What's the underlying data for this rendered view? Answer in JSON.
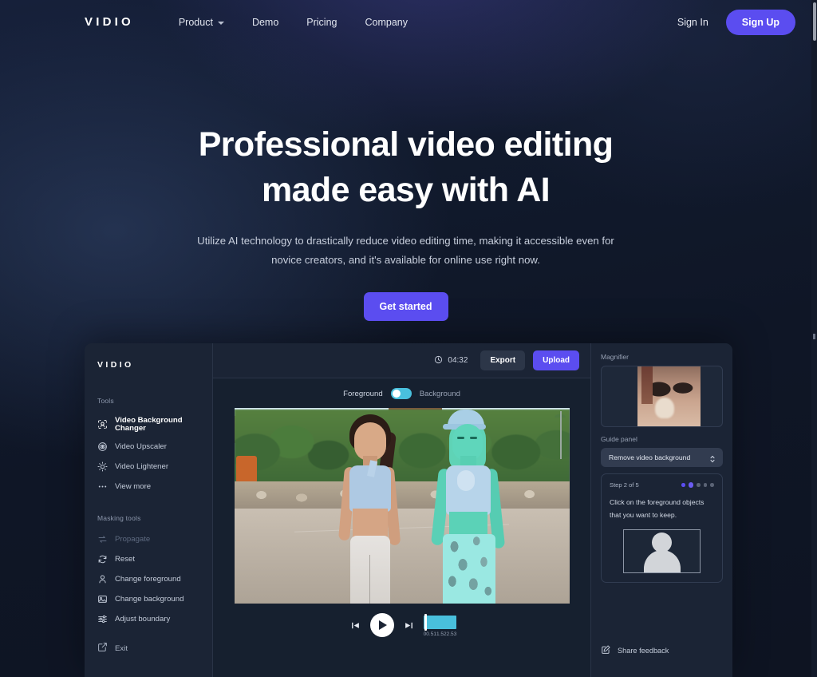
{
  "nav": {
    "brand": "VIDIO",
    "links": [
      {
        "label": "Product",
        "has_caret": true
      },
      {
        "label": "Demo",
        "has_caret": false
      },
      {
        "label": "Pricing",
        "has_caret": false
      },
      {
        "label": "Company",
        "has_caret": false
      }
    ],
    "sign_in": "Sign In",
    "sign_up": "Sign Up"
  },
  "hero": {
    "title_line1": "Professional video editing",
    "title_line2": "made easy with AI",
    "subtitle": "Utilize AI technology to drastically reduce video editing time, making it accessible even for novice creators, and it's available for online use right now.",
    "cta": "Get started"
  },
  "app": {
    "brand": "VIDIO",
    "sidebar": {
      "tools_label": "Tools",
      "tools": [
        {
          "label": "Video Background Changer",
          "icon": "select-subject-icon",
          "active": true,
          "disabled": false
        },
        {
          "label": "Video Upscaler",
          "icon": "eye-icon",
          "active": false,
          "disabled": false
        },
        {
          "label": "Video Lightener",
          "icon": "brightness-icon",
          "active": false,
          "disabled": false
        },
        {
          "label": "View more",
          "icon": "ellipsis-icon",
          "active": false,
          "disabled": false
        }
      ],
      "masking_label": "Masking tools",
      "masking": [
        {
          "label": "Propagate",
          "icon": "propagate-arrows-icon",
          "active": false,
          "disabled": true
        },
        {
          "label": "Reset",
          "icon": "refresh-icon",
          "active": false,
          "disabled": false
        },
        {
          "label": "Change foreground",
          "icon": "person-icon",
          "active": false,
          "disabled": false
        },
        {
          "label": "Change background",
          "icon": "image-icon",
          "active": false,
          "disabled": false
        },
        {
          "label": "Adjust boundary",
          "icon": "sliders-icon",
          "active": false,
          "disabled": false
        }
      ],
      "exit": "Exit"
    },
    "topbar": {
      "timer": "04:32",
      "export": "Export",
      "upload": "Upload"
    },
    "stage": {
      "foreground_label": "Foreground",
      "background_label": "Background",
      "toggle_position": "left"
    },
    "player": {
      "prev_icon": "skip-back-icon",
      "play_icon": "play-icon",
      "next_icon": "skip-forward-icon",
      "ticks": [
        "0",
        "0.5",
        "1",
        "1.5",
        "2",
        "2.5",
        "3"
      ],
      "playhead_percent": 4.3
    },
    "right_panel": {
      "magnifier_label": "Magnifier",
      "guide_label": "Guide panel",
      "guide_select_value": "Remove video background",
      "step_text": "Step 2 of 5",
      "step_dots": [
        "done",
        "cur",
        "todo",
        "todo",
        "todo"
      ],
      "instruction_line1": "Click on the foreground objects",
      "instruction_line2": "that you want to keep.",
      "share_feedback": "Share feedback"
    }
  },
  "colors": {
    "accent_purple": "#5b4df0",
    "accent_cyan": "#49c0dd",
    "page_bg": "#111a2d",
    "panel_bg": "#1b2435",
    "stage_bg": "#16202f"
  }
}
